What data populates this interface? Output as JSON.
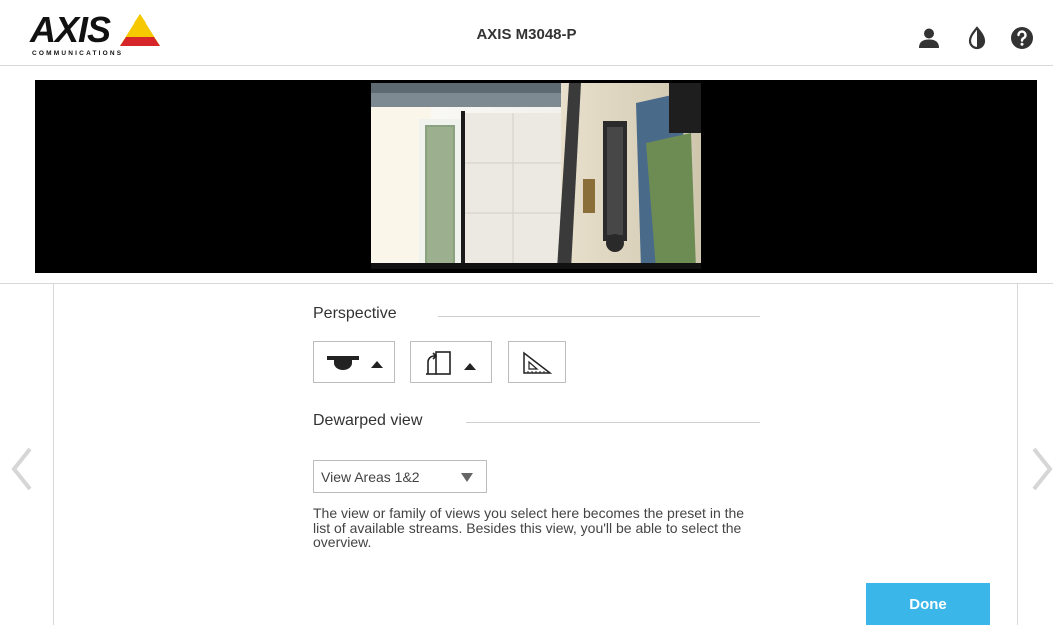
{
  "header": {
    "logo_word": "AXIS",
    "logo_sub": "COMMUNICATIONS",
    "title": "AXIS M3048-P",
    "icons": [
      "user-icon",
      "contrast-icon",
      "help-icon"
    ]
  },
  "perspective": {
    "title": "Perspective",
    "buttons": [
      "ceiling-mount-icon",
      "rotate-view-icon",
      "ruler-triangle-icon"
    ]
  },
  "dewarped": {
    "title": "Dewarped view",
    "select_value": "View Areas 1&2",
    "description": "The view or family of views you select here becomes the preset in the list of available streams. Besides this view, you'll be able to select the overview."
  },
  "actions": {
    "done_label": "Done"
  },
  "colors": {
    "accent": "#3ab6e8",
    "logo_yellow": "#f5c800",
    "logo_red": "#d7262a"
  }
}
